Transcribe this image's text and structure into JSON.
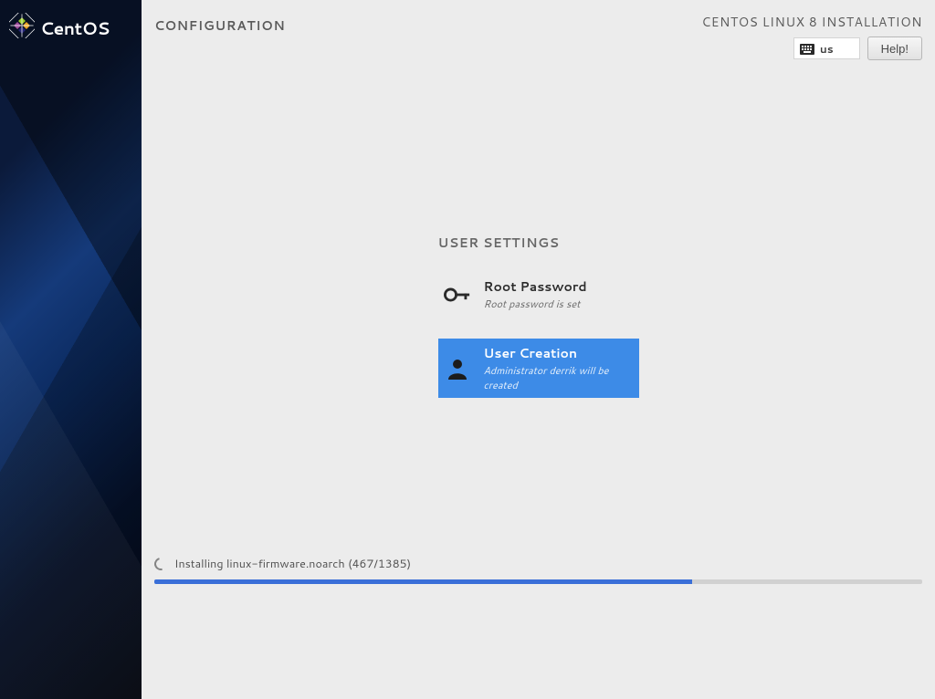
{
  "brand": "CentOS",
  "header": {
    "page_title": "CONFIGURATION",
    "product_title": "CENTOS LINUX 8 INSTALLATION",
    "keyboard_layout": "us",
    "help_label": "Help!"
  },
  "user_settings": {
    "heading": "USER SETTINGS",
    "root_password": {
      "title": "Root Password",
      "status": "Root password is set"
    },
    "user_creation": {
      "title": "User Creation",
      "status": "Administrator derrik will be created"
    }
  },
  "progress": {
    "status_text": "Installing linux-firmware.noarch (467/1385)",
    "percent": 70
  },
  "colors": {
    "accent": "#3d8be7",
    "progress": "#3a6fd8"
  }
}
